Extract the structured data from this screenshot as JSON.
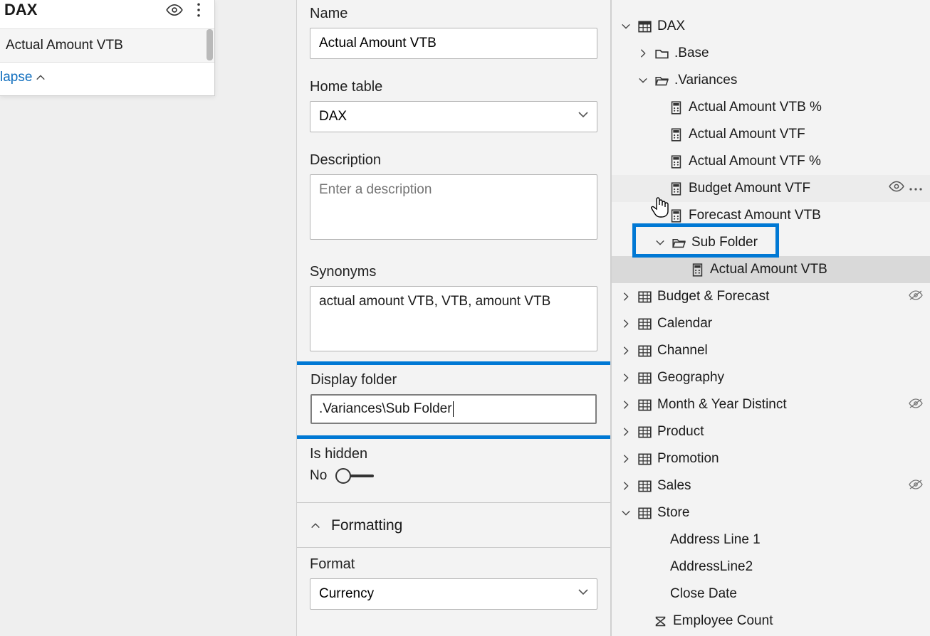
{
  "leftPane": {
    "title": "DAX",
    "searchValue": "Actual Amount VTB",
    "collapseLabel": "lapse"
  },
  "props": {
    "nameLabel": "Name",
    "nameValue": "Actual Amount VTB",
    "homeTableLabel": "Home table",
    "homeTableValue": "DAX",
    "descriptionLabel": "Description",
    "descriptionPlaceholder": "Enter a description",
    "synonymsLabel": "Synonyms",
    "synonymsValue": "actual amount VTB, VTB, amount VTB",
    "displayFolderLabel": "Display folder",
    "displayFolderValue": ".Variances\\Sub Folder",
    "isHiddenLabel": "Is hidden",
    "isHiddenValue": "No",
    "formattingHeader": "Formatting",
    "formatLabel": "Format",
    "formatValue": "Currency"
  },
  "tree": {
    "dax": "DAX",
    "base": ".Base",
    "variances": ".Variances",
    "measures": {
      "m0": "Actual Amount VTB %",
      "m1": "Actual Amount VTF",
      "m2": "Actual Amount VTF %",
      "m3": "Budget Amount VTF",
      "m4": "Forecast Amount VTB"
    },
    "subfolder": "Sub Folder",
    "selectedMeasure": "Actual Amount VTB",
    "tables": {
      "t0": "Budget & Forecast",
      "t1": "Calendar",
      "t2": "Channel",
      "t3": "Geography",
      "t4": "Month & Year Distinct",
      "t5": "Product",
      "t6": "Promotion",
      "t7": "Sales",
      "t8": "Store"
    },
    "storeCols": {
      "c0": "Address Line 1",
      "c1": "AddressLine2",
      "c2": "Close Date",
      "c3": "Employee Count"
    }
  }
}
